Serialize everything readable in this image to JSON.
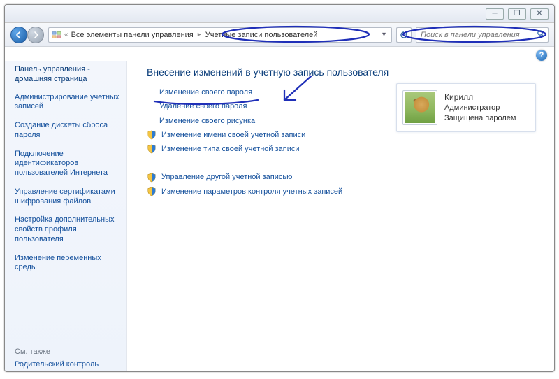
{
  "breadcrumb": {
    "root_icon": "control-panel-icon",
    "root": "Все элементы панели управления",
    "current": "Учетные записи пользователей"
  },
  "search": {
    "placeholder": "Поиск в панели управления"
  },
  "sidebar": {
    "heading": "Панель управления - домашняя страница",
    "items": [
      "Администрирование учетных записей",
      "Создание дискеты сброса пароля",
      "Подключение идентификаторов пользователей Интернета",
      "Управление сертификатами шифрования файлов",
      "Настройка дополнительных свойств профиля пользователя",
      "Изменение переменных среды"
    ],
    "see_also_heading": "См. также",
    "see_also": [
      "Родительский контроль"
    ]
  },
  "main": {
    "title": "Внесение изменений в учетную запись пользователя",
    "actions_plain": [
      "Изменение своего пароля",
      "Удаление своего пароля",
      "Изменение своего рисунка"
    ],
    "actions_shield_1": [
      "Изменение имени своей учетной записи",
      "Изменение типа своей учетной записи"
    ],
    "actions_shield_2": [
      "Управление другой учетной записью",
      "Изменение параметров контроля учетных записей"
    ]
  },
  "user": {
    "name": "Кирилл",
    "role": "Администратор",
    "status": "Защищена паролем"
  }
}
